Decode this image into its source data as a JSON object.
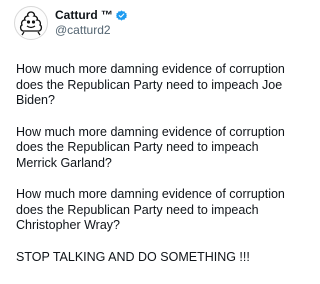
{
  "author": {
    "display_name": "Catturd ™",
    "handle": "@catturd2",
    "verified": true,
    "verified_color": "#1d9bf0",
    "avatar_icon": "cartoon-turd-avatar-icon"
  },
  "tweet": {
    "paragraphs": [
      "How much more damning evidence of corruption does the Republican Party need to impeach Joe Biden?",
      "How much more damning evidence of corruption does the Republican Party need to impeach Merrick Garland?",
      "How much more damning evidence of corruption does the Republican Party need to impeach Christopher Wray?",
      "STOP TALKING AND DO SOMETHING !!!"
    ]
  }
}
